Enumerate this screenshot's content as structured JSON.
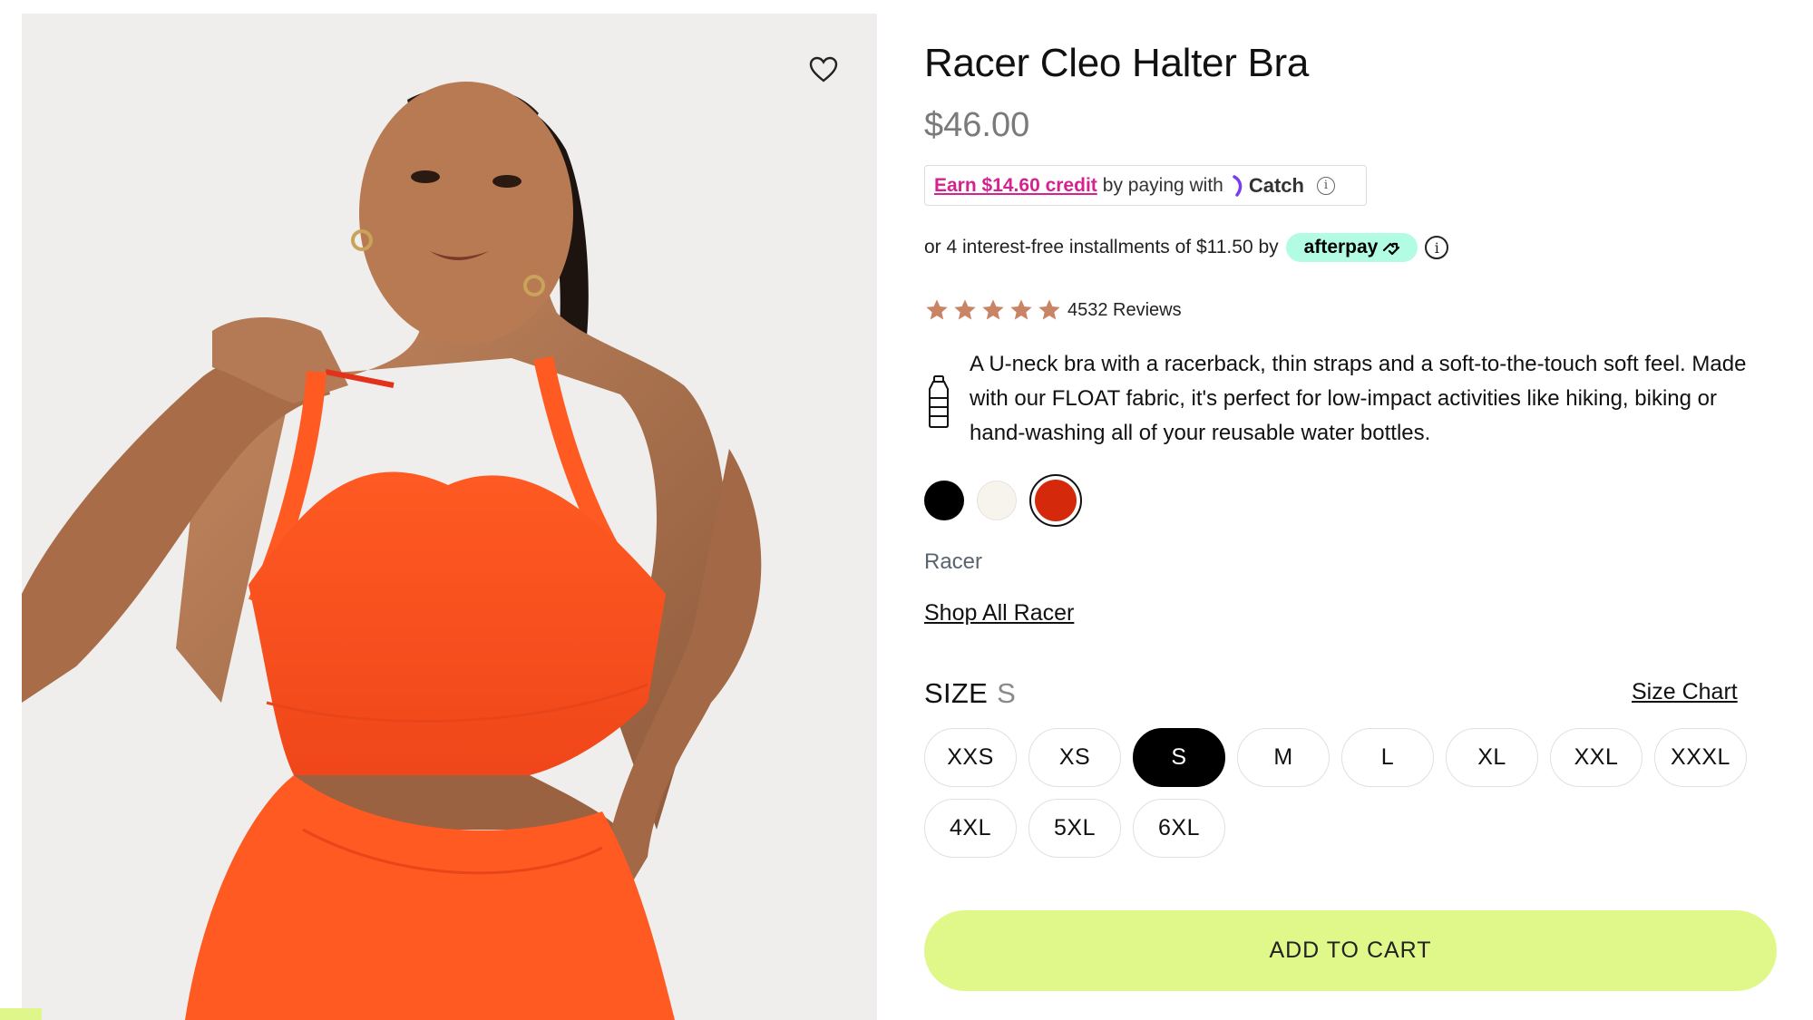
{
  "product": {
    "title": "Racer Cleo Halter Bra",
    "price": "$46.00",
    "image_alt": "model-wearing-orange-racer-bra",
    "wishlist_icon": "heart-outline-icon"
  },
  "catch": {
    "link_text": "Earn $14.60 credit",
    "middle_text": "by paying with",
    "brand": "Catch",
    "info_glyph": "i"
  },
  "afterpay": {
    "text": "or 4 interest-free installments of $11.50 by",
    "brand": "afterpay",
    "info_glyph": "i",
    "badge_color": "#b2fce4"
  },
  "rating": {
    "stars": 5,
    "star_color": "#c98466",
    "reviews": "4532 Reviews"
  },
  "description": {
    "icon": "water-bottle-icon",
    "text": "A U-neck bra with a racerback, thin straps and a soft-to-the-touch soft feel. Made with our FLOAT fabric, it's perfect for low-impact activities like hiking, biking or hand-washing all of your reusable water bottles."
  },
  "colors": {
    "swatches": [
      "#000000",
      "#f7f4ee",
      "#d42a0b"
    ],
    "selected_index": 2
  },
  "collection": {
    "name": "Racer",
    "shop_all": "Shop All Racer"
  },
  "size": {
    "heading": "SIZE",
    "selected": "S",
    "chart_link": "Size Chart",
    "options": [
      "XXS",
      "XS",
      "S",
      "M",
      "L",
      "XL",
      "XXL",
      "XXXL",
      "4XL",
      "5XL",
      "6XL"
    ]
  },
  "cart": {
    "button_label": "ADD TO CART",
    "button_color": "#e0f78a"
  }
}
